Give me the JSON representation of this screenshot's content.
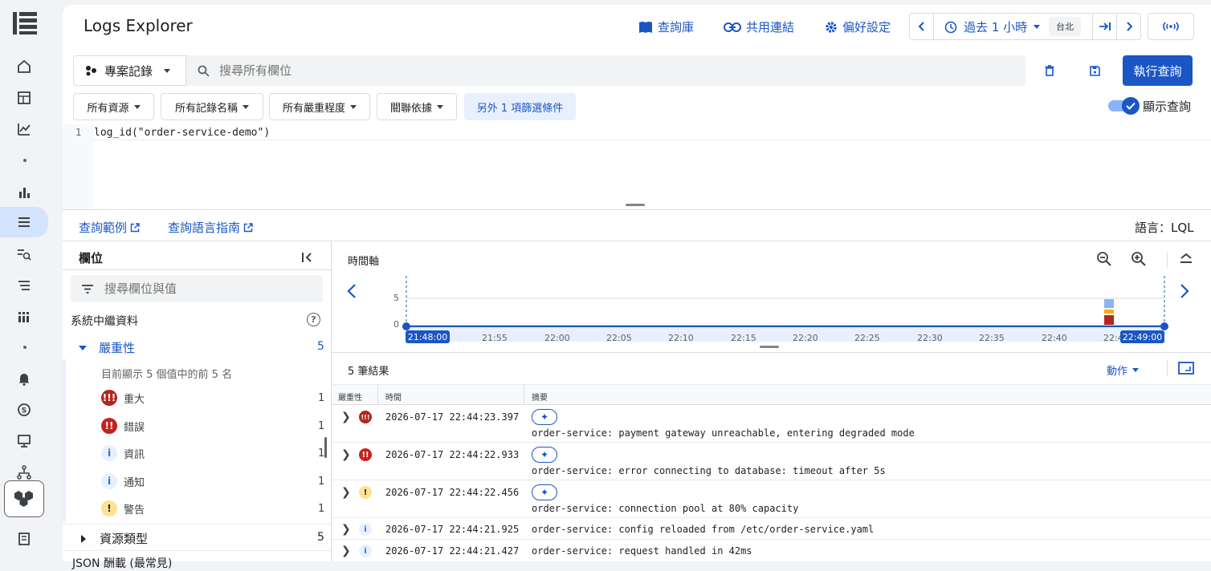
{
  "app": {
    "title": "Logs Explorer"
  },
  "toolbar": {
    "library": "查詢庫",
    "share": "共用連結",
    "prefs": "偏好設定",
    "time_range": "過去 1 小時",
    "timezone": "台北"
  },
  "query": {
    "scope": "專案記錄",
    "search_placeholder": "搜尋所有欄位",
    "run": "執行查詢",
    "show_query": "顯示查詢",
    "line_no": "1",
    "text": "log_id(\"order-service-demo\")"
  },
  "filters": {
    "resource": "所有資源",
    "log_name": "所有記錄名稱",
    "severity": "所有嚴重程度",
    "correlate": "關聯依據",
    "more": "另外 1 項篩選條件"
  },
  "links": {
    "examples": "查詢範例",
    "guide": "查詢語言指南",
    "language": "語言：LQL"
  },
  "fields": {
    "header": "欄位",
    "search_placeholder": "搜尋欄位與值",
    "system_meta": "系統中繼資料",
    "severity_label": "嚴重性",
    "severity_count": "5",
    "showing": "目前顯示 5 個值中的前 5 名",
    "items": [
      {
        "label": "重大",
        "count": "1",
        "color": "#b3261e"
      },
      {
        "label": "錯誤",
        "count": "1",
        "color": "#c5221f"
      },
      {
        "label": "資訊",
        "count": "1",
        "color": "#1a73e8"
      },
      {
        "label": "通知",
        "count": "1",
        "color": "#1a73e8"
      },
      {
        "label": "警告",
        "count": "1",
        "color": "#f9ab00"
      }
    ],
    "resource_type": "資源類型",
    "resource_count": "5",
    "json_payload": "JSON 酬載 (最常見)"
  },
  "timeline": {
    "title": "時間軸",
    "y_ticks": [
      "5",
      "0"
    ],
    "start": "21:48:00",
    "end": "22:49:00",
    "ticks": [
      "21:55",
      "22:00",
      "22:05",
      "22:10",
      "22:15",
      "22:20",
      "22:25",
      "22:30",
      "22:35",
      "22:40",
      "22:4"
    ]
  },
  "results": {
    "count": "5 筆結果",
    "actions": "動作",
    "col_severity": "嚴重性",
    "col_time": "時間",
    "col_summary": "摘要",
    "rows": [
      {
        "sev": "critical",
        "time": "2026-07-17 22:44:23.397",
        "msg": "order-service: payment gateway unreachable, entering degraded mode"
      },
      {
        "sev": "error",
        "time": "2026-07-17 22:44:22.933",
        "msg": "order-service: error connecting to database: timeout after 5s"
      },
      {
        "sev": "warning",
        "time": "2026-07-17 22:44:22.456",
        "msg": "order-service: connection pool at 80% capacity"
      },
      {
        "sev": "info",
        "time": "2026-07-17 22:44:21.925",
        "msg": "order-service: config reloaded from /etc/order-service.yaml"
      },
      {
        "sev": "info",
        "time": "2026-07-17 22:44:21.427",
        "msg": "order-service: request handled in 42ms"
      }
    ]
  }
}
